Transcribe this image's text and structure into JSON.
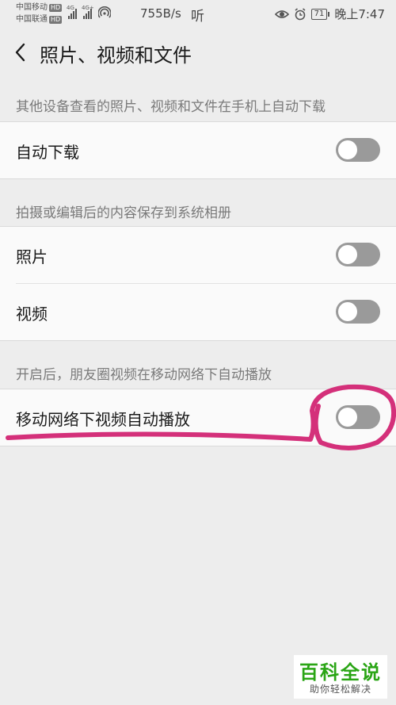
{
  "status_bar": {
    "carrier1": "中国移动",
    "carrier2": "中国联通",
    "hd_badge": "HD",
    "net1": "4G",
    "net2": "4G+",
    "speed": "755B/s",
    "listen_glyph": "听",
    "battery_level": "71",
    "time": "晚上7:47",
    "icons": [
      "signal-icon",
      "wifi-hotspot-icon",
      "eye-icon",
      "alarm-icon",
      "battery-icon"
    ]
  },
  "header": {
    "back_icon": "chevron-left-icon",
    "title": "照片、视频和文件"
  },
  "sections": [
    {
      "caption": "其他设备查看的照片、视频和文件在手机上自动下载",
      "rows": [
        {
          "label": "自动下载",
          "toggle_on": false
        }
      ]
    },
    {
      "caption": "拍摄或编辑后的内容保存到系统相册",
      "rows": [
        {
          "label": "照片",
          "toggle_on": false
        },
        {
          "label": "视频",
          "toggle_on": false
        }
      ]
    },
    {
      "caption": "开启后，朋友圈视频在移动网络下自动播放",
      "rows": [
        {
          "label": "移动网络下视频自动播放",
          "toggle_on": false
        }
      ]
    }
  ],
  "annotation_color": "#d4307a",
  "watermark": {
    "title": "百科全说",
    "subtitle": "助你轻松解决",
    "color": "#2aa515"
  }
}
